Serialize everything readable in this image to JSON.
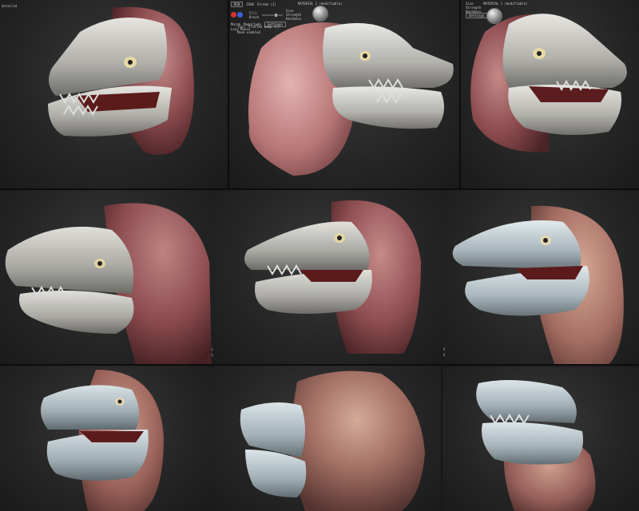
{
  "hud": {
    "panel1_corner": "detailed",
    "panel2": {
      "tab_label": "RGB",
      "zadd_label": "ZSUB",
      "stroke_label": "Stroke (1)",
      "size_label": "Size",
      "strength_label": "Strength",
      "hardness_label": "Hardness",
      "material_label": "MATERIAL 1 (modifiable)",
      "button_label": "Settings",
      "fill_label": "Fill",
      "brush_label": "Brush",
      "morph_label": "Morph",
      "magnitude_label": "Magnitude",
      "lazy_label": "Lazy Mouse",
      "tool_status": "Tool: flatten bump (F)",
      "mask_status": "Mask enabled"
    },
    "panel3": {
      "size_label": "Size",
      "strength_label": "Strength",
      "hardness_label": "Hardness",
      "material_label": "MATERIAL 1 (modifiable)",
      "button_label": "Settings"
    },
    "side_marks": [
      "L",
      "L",
      "S",
      "S"
    ]
  },
  "colors": {
    "accent_red": "#d53232",
    "accent_blue": "#3a5fd8",
    "skin_pink": "#b36e6e",
    "clay_grey": "#c6c6c1",
    "clay_blue": "#aebcc2"
  },
  "panels": [
    {
      "name": "render-1",
      "snout": "grey",
      "skull": "maroon",
      "facing": "left"
    },
    {
      "name": "render-2",
      "snout": "grey",
      "skull": "pink",
      "facing": "right"
    },
    {
      "name": "render-3",
      "snout": "grey",
      "skull": "maroon",
      "facing": "right"
    },
    {
      "name": "render-4",
      "snout": "grey",
      "skull": "maroon",
      "facing": "left"
    },
    {
      "name": "render-5",
      "snout": "grey",
      "skull": "maroon",
      "facing": "left"
    },
    {
      "name": "render-6",
      "snout": "blue-grey",
      "skull": "tan",
      "facing": "left"
    },
    {
      "name": "render-7",
      "snout": "blue-grey",
      "skull": "tan",
      "facing": "left"
    },
    {
      "name": "render-8",
      "snout": "blue-grey",
      "skull": "tan",
      "facing": "back"
    },
    {
      "name": "render-9",
      "snout": "blue-grey",
      "skull": "tan",
      "facing": "right"
    }
  ]
}
